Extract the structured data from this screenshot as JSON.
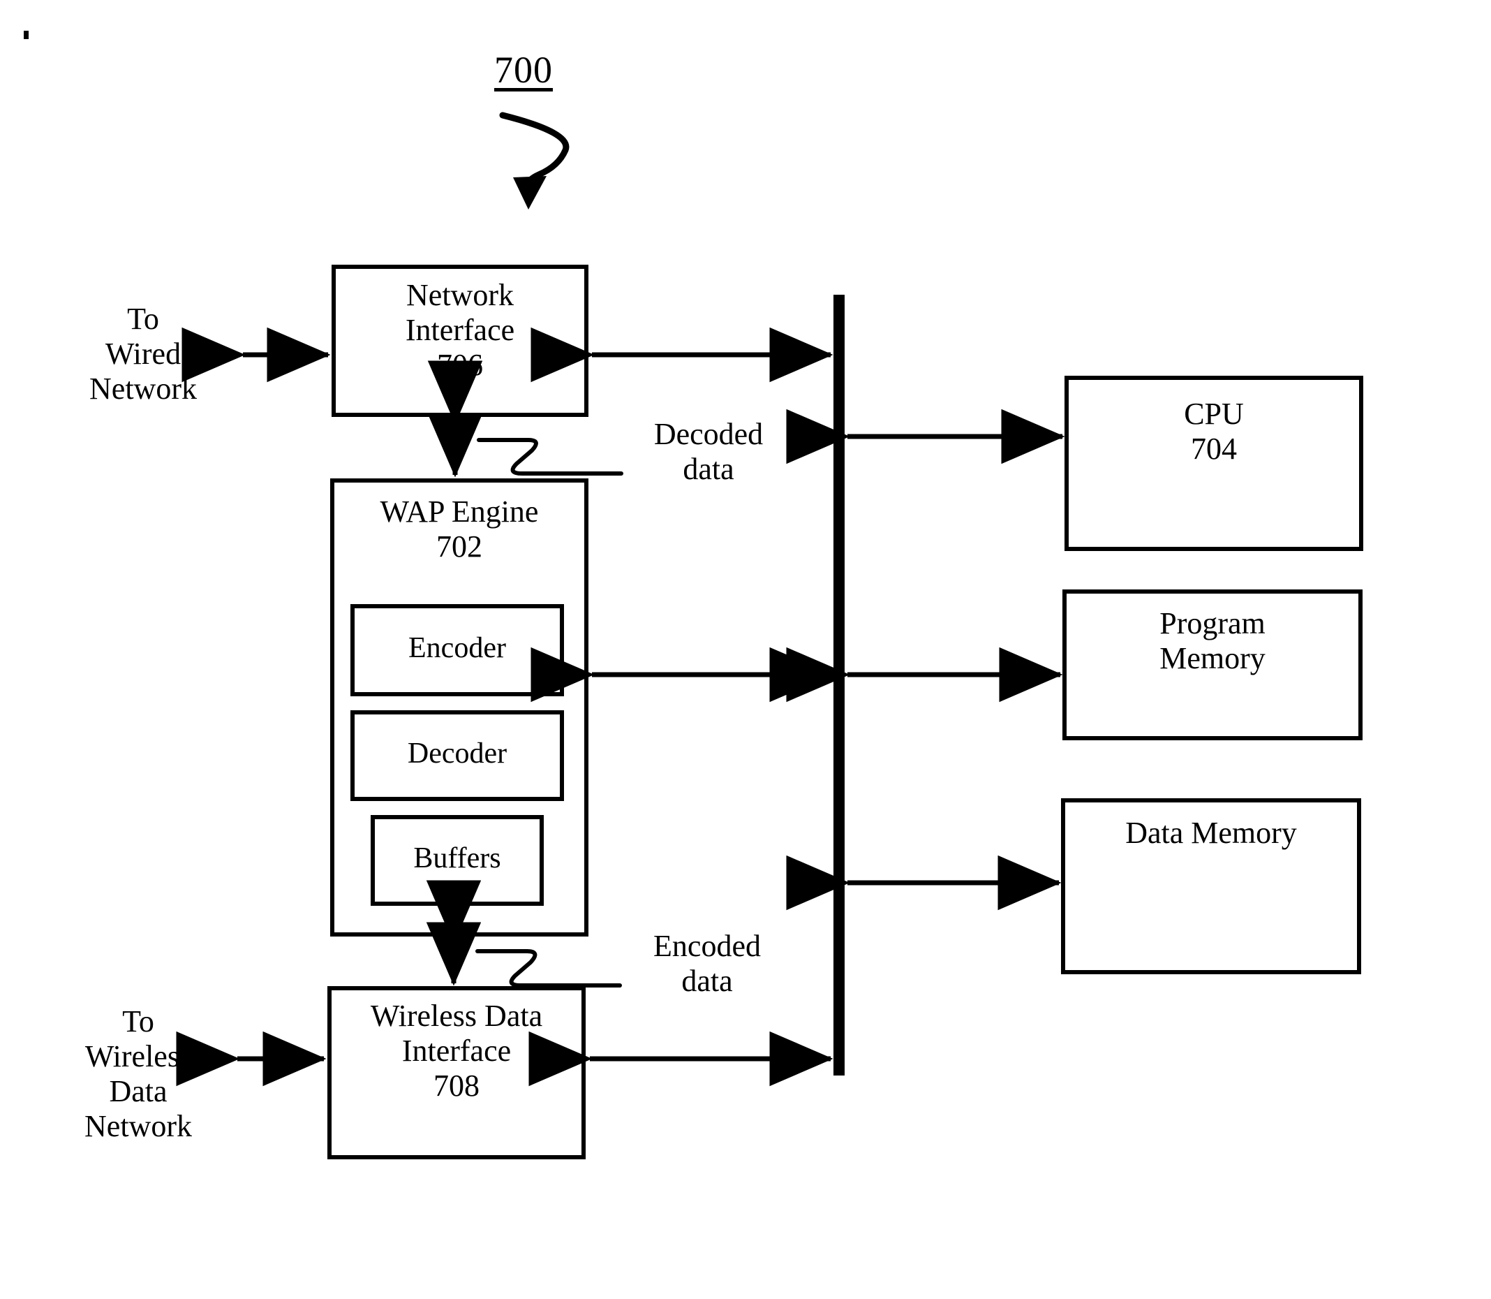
{
  "figure": {
    "number": "700",
    "type": "patent-block-diagram"
  },
  "blocks": {
    "network_interface": {
      "title": "Network\nInterface\n706",
      "name": "Network Interface",
      "ref": "706"
    },
    "wap_engine": {
      "title": "WAP Engine\n702",
      "name": "WAP Engine",
      "ref": "702"
    },
    "encoder": {
      "title": "Encoder"
    },
    "decoder": {
      "title": "Decoder"
    },
    "buffers": {
      "title": "Buffers"
    },
    "wireless_data_interface": {
      "title": "Wireless Data\nInterface\n708",
      "name": "Wireless Data Interface",
      "ref": "708"
    },
    "cpu": {
      "title": "CPU\n704",
      "name": "CPU",
      "ref": "704"
    },
    "program_memory": {
      "title": "Program\nMemory"
    },
    "data_memory": {
      "title": "Data Memory"
    }
  },
  "side_labels": {
    "to_wired_network": "To\nWired\nNetwork",
    "to_wireless_data_network": "To\nWireless\nData\nNetwork"
  },
  "annotations": {
    "decoded_data": "Decoded\ndata",
    "encoded_data": "Encoded\ndata"
  },
  "colors": {
    "line": "#000000",
    "background": "#ffffff"
  }
}
